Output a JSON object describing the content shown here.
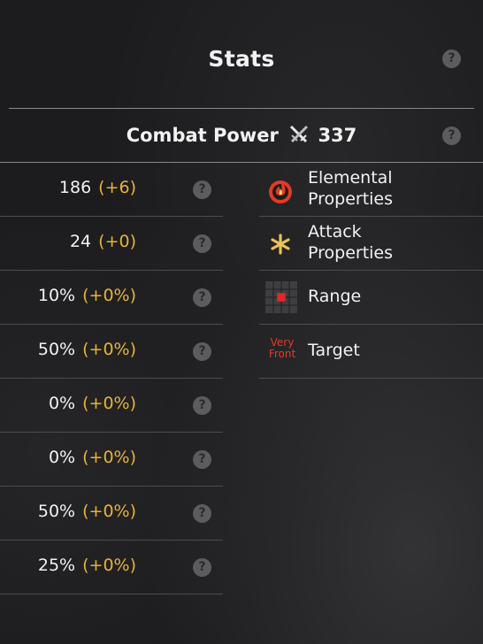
{
  "header": {
    "title": "Stats",
    "help": "?"
  },
  "combat_power": {
    "label": "Combat Power",
    "value": "337"
  },
  "stats": [
    {
      "value": "186",
      "bonus": "(+6)"
    },
    {
      "value": "24",
      "bonus": "(+0)"
    },
    {
      "value": "10%",
      "bonus": "(+0%)"
    },
    {
      "value": "50%",
      "bonus": "(+0%)"
    },
    {
      "value": "0%",
      "bonus": "(+0%)"
    },
    {
      "value": "0%",
      "bonus": "(+0%)"
    },
    {
      "value": "50%",
      "bonus": "(+0%)"
    },
    {
      "value": "25%",
      "bonus": "(+0%)"
    }
  ],
  "properties": {
    "elemental": {
      "line1": "Elemental",
      "line2": "Properties",
      "icon": "fire-icon"
    },
    "attack": {
      "line1": "Attack",
      "line2": "Properties",
      "icon": "star-icon"
    },
    "range": {
      "label": "Range",
      "icon": "range-grid-icon"
    },
    "target": {
      "label": "Target",
      "badge_line1": "Very",
      "badge_line2": "Front"
    }
  },
  "colors": {
    "bonus": "#e9b234",
    "fire": "#e23a2a",
    "star": "#e8c25a",
    "range_cell": "#e02828"
  }
}
